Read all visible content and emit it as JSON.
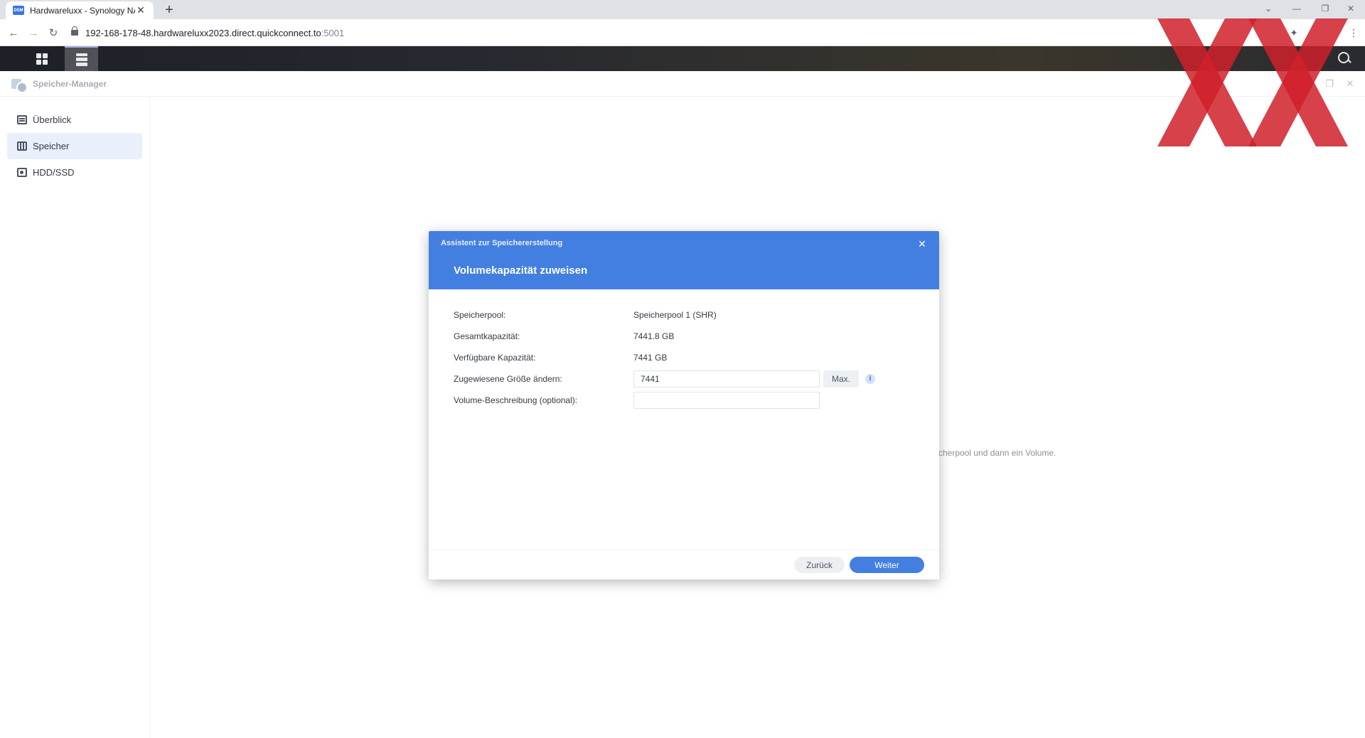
{
  "browser": {
    "tab_title": "Hardwareluxx - Synology NAS",
    "favicon_text": "DSM",
    "url_host": "192-168-178-48.hardwareluxx2023.direct.quickconnect.to",
    "url_port": ":5001",
    "icons": [
      "back-icon",
      "forward-icon",
      "reload-icon",
      "lock-icon",
      "extensions-icon",
      "menu-icon"
    ]
  },
  "app": {
    "title": "Speicher-Manager"
  },
  "sidebar": {
    "items": [
      {
        "label": "Überblick",
        "icon": "overview-icon",
        "active": false
      },
      {
        "label": "Speicher",
        "icon": "storage-icon",
        "active": true
      },
      {
        "label": "HDD/SSD",
        "icon": "disk-icon",
        "active": false
      }
    ]
  },
  "background_hint": "cherpool und dann ein Volume.",
  "dialog": {
    "wizard_title": "Assistent zur Speichererstellung",
    "step_title": "Volumekapazität zuweisen",
    "fields": {
      "pool_label": "Speicherpool:",
      "pool_value": "Speicherpool 1 (SHR)",
      "total_label": "Gesamtkapazität:",
      "total_value": "7441.8 GB",
      "avail_label": "Verfügbare Kapazität:",
      "avail_value": "7441 GB",
      "size_label": "Zugewiesene Größe ändern:",
      "size_value": "7441",
      "max_label": "Max.",
      "desc_label": "Volume-Beschreibung (optional):",
      "desc_value": ""
    },
    "back_label": "Zurück",
    "next_label": "Weiter"
  },
  "colors": {
    "accent": "#437fe0",
    "watermark": "#d0202a"
  }
}
